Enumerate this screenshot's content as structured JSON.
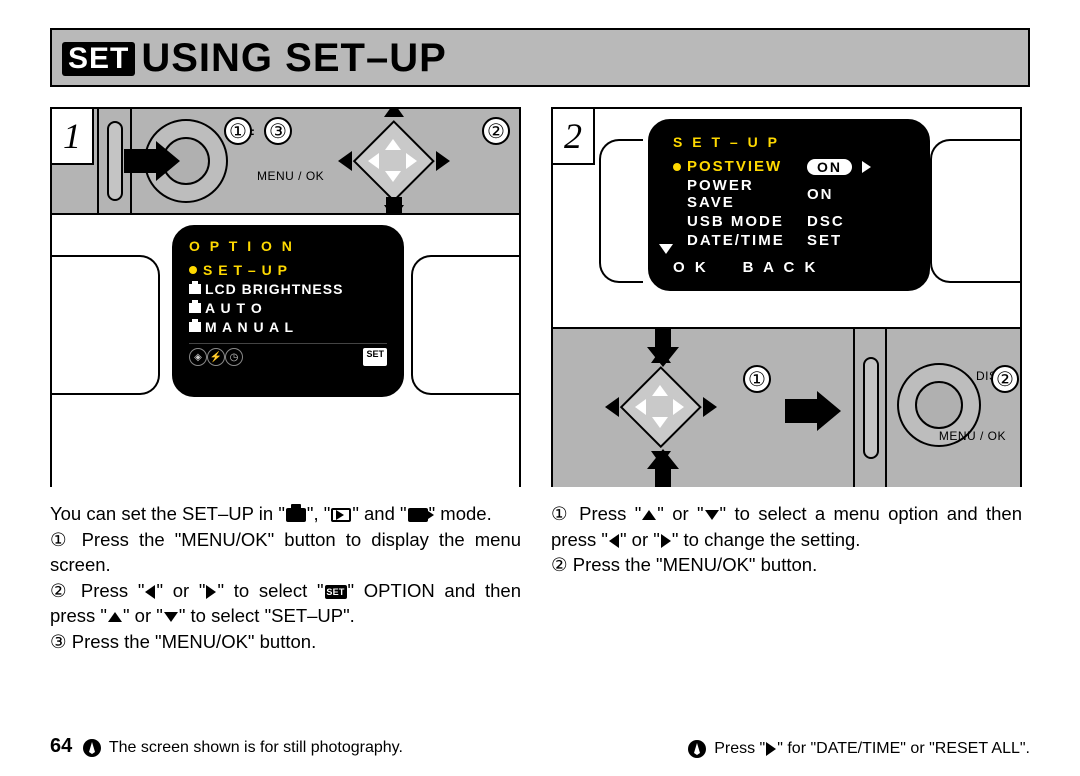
{
  "page_number": "64",
  "title_badge": "SET",
  "title": "USING SET–UP",
  "step1": {
    "number": "1",
    "hw_labels": {
      "f": "F",
      "menu_ok": "MENU / OK"
    },
    "callouts": {
      "c1": "①",
      "c2": "②",
      "c3": "③"
    },
    "lcd": {
      "title": "O P T I O N",
      "items": [
        {
          "label": "S E T – U P",
          "selected": true
        },
        {
          "label": "LCD BRIGHTNESS",
          "icon": "camera"
        },
        {
          "label": "A U T O",
          "icon": "camera"
        },
        {
          "label": "M A N U A L",
          "icon": "camera"
        }
      ],
      "foot_set": "SET"
    }
  },
  "step2": {
    "number": "2",
    "hw_labels": {
      "disp": "DISP",
      "menu_ok": "MENU / OK"
    },
    "callouts": {
      "c1": "①",
      "c2": "②"
    },
    "lcd": {
      "title": "S E T – U P",
      "rows": [
        {
          "label": "POSTVIEW",
          "value": "ON",
          "selected": true,
          "pill": true
        },
        {
          "label": "POWER SAVE",
          "value": "ON"
        },
        {
          "label": "USB MODE",
          "value": "DSC"
        },
        {
          "label": "DATE/TIME",
          "value": "SET"
        }
      ],
      "foot_ok": "O K",
      "foot_back": "B A C K"
    }
  },
  "instructions": {
    "left": {
      "intro_a": "You can set the SET–UP in \"",
      "intro_b": "\", \"",
      "intro_c": "\" and \"",
      "intro_d": "\" mode.",
      "l1_num": "①",
      "l1": "Press the \"MENU/OK\" button to display the menu screen.",
      "l2_num": "②",
      "l2a": "Press \"",
      "l2b": "\" or \"",
      "l2c": "\" to select \"",
      "l2d": "\" OPTION and then press \"",
      "l2e": "\" or \"",
      "l2f": "\" to select \"SET–UP\".",
      "l3_num": "③",
      "l3": "Press the \"MENU/OK\" button."
    },
    "right": {
      "l1_num": "①",
      "l1a": "Press \"",
      "l1b": "\" or \"",
      "l1c": "\" to select a menu option and then press \"",
      "l1d": "\" or \"",
      "l1e": "\" to change the setting.",
      "l2_num": "②",
      "l2": "Press the \"MENU/OK\" button."
    }
  },
  "footer": {
    "left_note": "The screen shown is for still photography.",
    "right_note_a": "Press \"",
    "right_note_b": "\" for \"DATE/TIME\" or \"RESET ALL\"."
  }
}
